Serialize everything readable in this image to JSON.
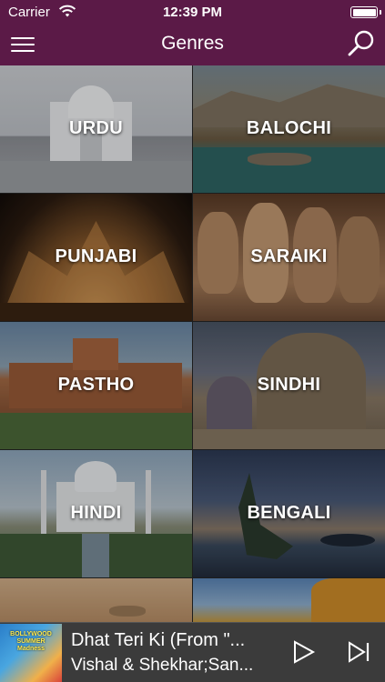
{
  "status_bar": {
    "carrier": "Carrier",
    "time": "12:39 PM",
    "wifi_icon": "wifi-icon",
    "battery_icon": "battery-icon"
  },
  "nav": {
    "title": "Genres",
    "menu_icon": "hamburger-menu-icon",
    "search_icon": "search-icon"
  },
  "genres": [
    {
      "label": "URDU"
    },
    {
      "label": "BALOCHI"
    },
    {
      "label": "PUNJABI"
    },
    {
      "label": "SARAIKI"
    },
    {
      "label": "PASTHO"
    },
    {
      "label": "SINDHI"
    },
    {
      "label": "HINDI"
    },
    {
      "label": "BENGALI"
    }
  ],
  "now_playing": {
    "song": "Dhat Teri Ki (From \"...",
    "artist": "Vishal & Shekhar;San...",
    "album_art_text": "BOLLYWOOD SUMMER Madness",
    "play_icon": "play-icon",
    "next_icon": "next-track-icon"
  },
  "colors": {
    "nav_bar": "#5b1a47",
    "player_bar": "#3b3b3b",
    "text": "#ffffff"
  }
}
